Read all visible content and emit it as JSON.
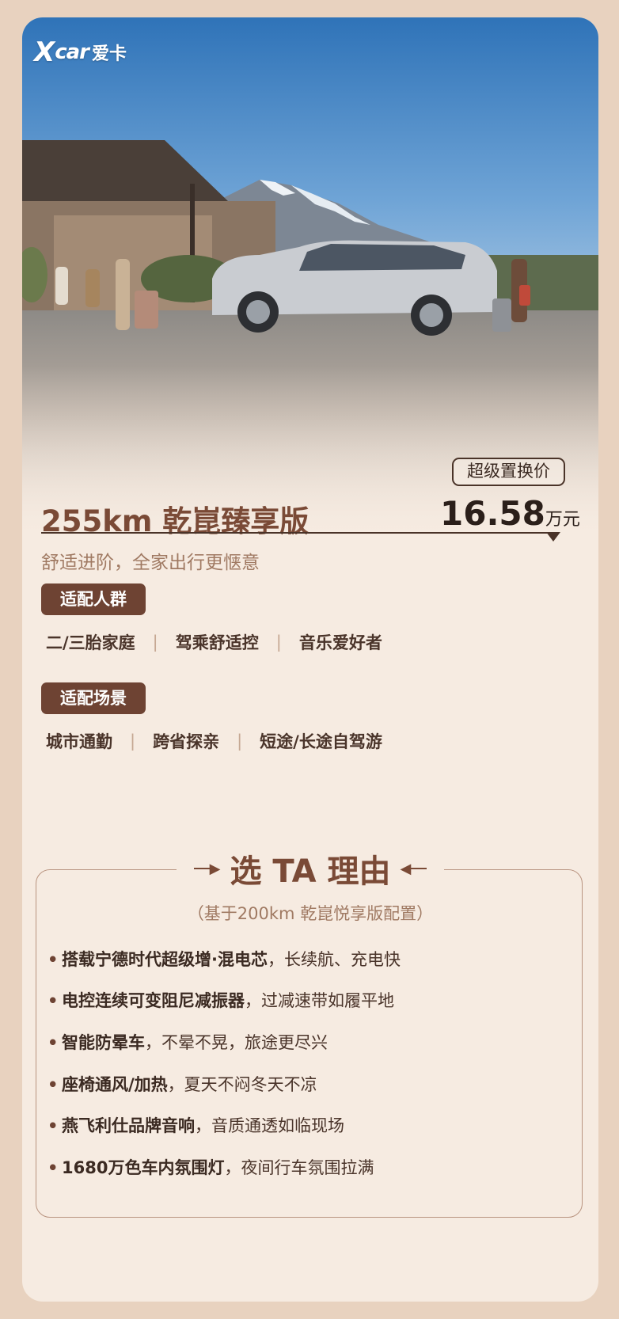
{
  "logo": {
    "mark": "X",
    "car": "car",
    "cn": "爱卡"
  },
  "badge": {
    "label": "超级置换价"
  },
  "title": "255km 乾崑臻享版",
  "price": {
    "value": "16.58",
    "unit": "万元"
  },
  "subtitle": "舒适进阶，全家出行更惬意",
  "audience": {
    "label": "适配人群",
    "tags": [
      "二/三胎家庭",
      "驾乘舒适控",
      "音乐爱好者"
    ]
  },
  "scenes": {
    "label": "适配场景",
    "tags": [
      "城市通勤",
      "跨省探亲",
      "短途/长途自驾游"
    ]
  },
  "reasons": {
    "title": "选 TA 理由",
    "note": "（基于200km 乾崑悦享版配置）",
    "items": [
      {
        "strong": "搭载宁德时代超级增·混电芯",
        "rest": "，长续航、充电快"
      },
      {
        "strong": "电控连续可变阻尼减振器",
        "rest": "，过减速带如履平地"
      },
      {
        "strong": "智能防晕车",
        "rest": "，不晕不晃，旅途更尽兴"
      },
      {
        "strong": "座椅通风/加热",
        "rest": "，夏天不闷冬天不凉"
      },
      {
        "strong": "燕飞利仕品牌音响",
        "rest": "，音质通透如临现场"
      },
      {
        "strong": "1680万色车内氛围灯",
        "rest": "，夜间行车氛围拉满"
      }
    ]
  },
  "icons": {
    "bullet": "•"
  },
  "colors": {
    "accent": "#7a4a36",
    "badge_bg": "#6e4333",
    "background": "#e8d2bf",
    "card": "#f6ebe1"
  }
}
